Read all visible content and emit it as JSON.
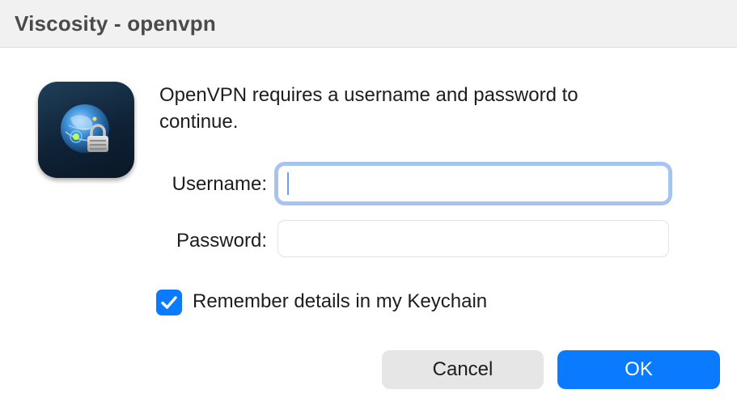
{
  "window": {
    "title": "Viscosity - openvpn"
  },
  "app_icon": {
    "icon": "viscosity-globe-lock-icon"
  },
  "dialog": {
    "message": "OpenVPN requires a username and password to continue.",
    "username_label": "Username:",
    "username_value": "",
    "password_label": "Password:",
    "password_value": "",
    "remember_label": "Remember details in my Keychain",
    "remember_checked": true,
    "cancel_label": "Cancel",
    "ok_label": "OK"
  },
  "colors": {
    "accent": "#0a7aff",
    "focus_ring": "#a7c3f1",
    "titlebar": "#f1f1f1"
  }
}
